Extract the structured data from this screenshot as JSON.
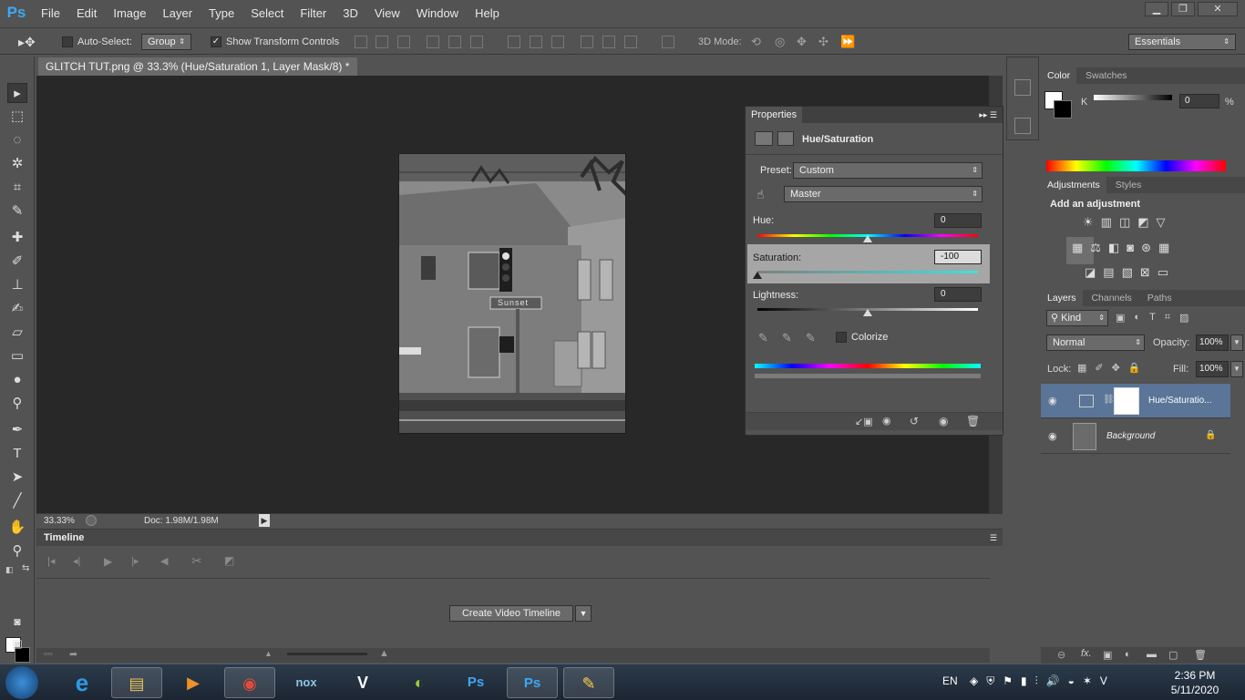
{
  "app": {
    "logo": "Ps"
  },
  "menu": [
    "File",
    "Edit",
    "Image",
    "Layer",
    "Type",
    "Select",
    "Filter",
    "3D",
    "View",
    "Window",
    "Help"
  ],
  "window_controls": {
    "minimize": "▁",
    "restore": "❐",
    "close": "✕"
  },
  "options": {
    "auto_select_label": "Auto-Select:",
    "auto_select_value": "Group",
    "show_transform_label": "Show Transform Controls",
    "mode_3d_label": "3D Mode:",
    "workspace": "Essentials"
  },
  "document": {
    "tab_title": "GLITCH TUT.png @ 33.3% (Hue/Saturation 1, Layer Mask/8) *",
    "tab_close": "×",
    "zoom": "33.33%",
    "doc_info": "Doc: 1.98M/1.98M",
    "sign_text": "Sunset"
  },
  "timeline": {
    "title": "Timeline",
    "create_button": "Create Video Timeline"
  },
  "properties": {
    "title": "Properties",
    "adjustment_name": "Hue/Saturation",
    "preset_label": "Preset:",
    "preset_value": "Custom",
    "channel_value": "Master",
    "hue_label": "Hue:",
    "hue_value": "0",
    "saturation_label": "Saturation:",
    "saturation_value": "-100",
    "lightness_label": "Lightness:",
    "lightness_value": "0",
    "colorize_label": "Colorize"
  },
  "color_panel": {
    "tabs": [
      "Color",
      "Swatches"
    ],
    "channel_label": "K",
    "value": "0",
    "unit": "%"
  },
  "adjustments_panel": {
    "tabs": [
      "Adjustments",
      "Styles"
    ],
    "heading": "Add an adjustment"
  },
  "layers_panel": {
    "tabs": [
      "Layers",
      "Channels",
      "Paths"
    ],
    "kind_filter": "Kind",
    "blend_mode": "Normal",
    "opacity_label": "Opacity:",
    "opacity_value": "100%",
    "lock_label": "Lock:",
    "fill_label": "Fill:",
    "fill_value": "100%",
    "layers": [
      {
        "name": "Hue/Saturatio..."
      },
      {
        "name": "Background"
      }
    ],
    "footer_fx": "fx."
  },
  "taskbar": {
    "language": "EN",
    "time": "2:36 PM",
    "date": "5/11/2020"
  },
  "colors": {
    "accent": "#3fa7f5",
    "panel": "#535353",
    "canvas_bg": "#282828",
    "selected_layer": "#5a7597"
  }
}
